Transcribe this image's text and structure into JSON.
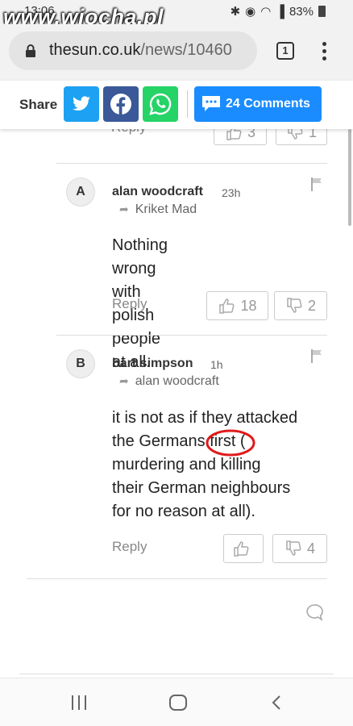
{
  "status_bar": {
    "time": "13:06",
    "battery": "83%",
    "watermark": "www.wiocha.pl"
  },
  "browser": {
    "url_domain": "thesun.co.uk",
    "url_path": "/news/10460",
    "tab_count": "1"
  },
  "share_bar": {
    "share_label": "Share",
    "comments_label": "24 Comments",
    "colors": {
      "twitter": "#1da1f2",
      "facebook": "#3b5998",
      "whatsapp": "#25d366",
      "comments": "#1a8cff"
    }
  },
  "previous_comment": {
    "reply_label": "Reply",
    "likes": "3",
    "dislikes": "1"
  },
  "comments": [
    {
      "avatar": "A",
      "author": "alan woodcraft",
      "time_ago": "23h",
      "reply_to": "Kriket Mad",
      "lines": [
        "Nothing wrong with",
        "polish people at all."
      ],
      "reply_label": "Reply",
      "likes": "18",
      "dislikes": "2"
    },
    {
      "avatar": "B",
      "author": "bart simpson",
      "time_ago": "1h",
      "reply_to": "alan woodcraft",
      "lines": [
        "it is not as if they attacked",
        "the Germans first (",
        "murdering and killing",
        "their German neighbours",
        "for no reason at all)."
      ],
      "reply_label": "Reply",
      "likes": "",
      "dislikes": "4"
    }
  ],
  "icons": [
    "lock-icon",
    "twitter-icon",
    "facebook-icon",
    "whatsapp-icon",
    "comment-bubble-icon",
    "flag-icon",
    "thumbs-up-icon",
    "thumbs-down-icon",
    "reply-arrow-icon",
    "chat-icon",
    "menu-dots-icon"
  ]
}
